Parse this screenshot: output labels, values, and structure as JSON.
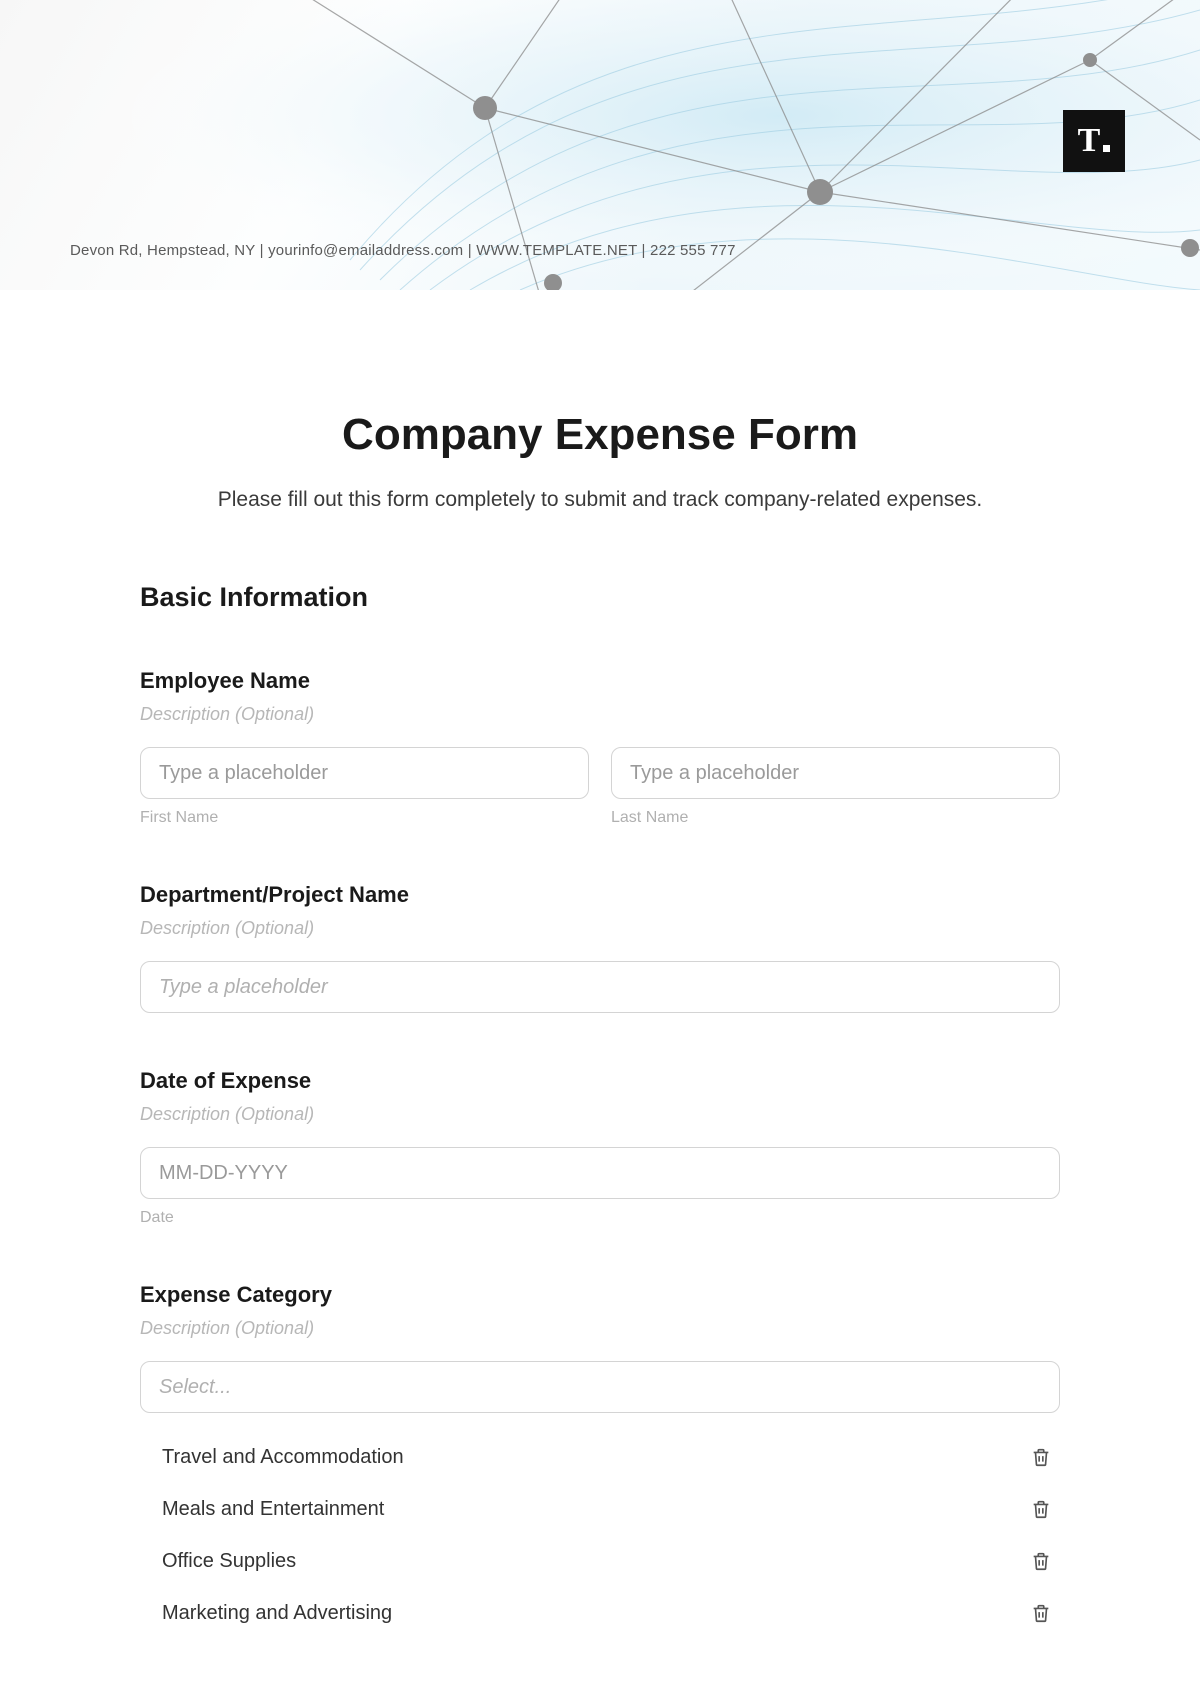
{
  "header": {
    "contact_line": "Devon Rd, Hempstead, NY | yourinfo@emailaddress.com | WWW.TEMPLATE.NET | 222 555 777",
    "logo_text": "T"
  },
  "title": "Company Expense Form",
  "subtitle": "Please fill out this form completely to submit and track company-related expenses.",
  "sections": {
    "basic_info": {
      "heading": "Basic Information",
      "employee_name": {
        "label": "Employee Name",
        "desc": "Description (Optional)",
        "first_placeholder": "Type a placeholder",
        "first_sublabel": "First Name",
        "last_placeholder": "Type a placeholder",
        "last_sublabel": "Last Name"
      },
      "department": {
        "label": "Department/Project Name",
        "desc": "Description (Optional)",
        "placeholder": "Type a placeholder"
      },
      "date": {
        "label": "Date of Expense",
        "desc": "Description (Optional)",
        "placeholder": "MM-DD-YYYY",
        "sublabel": "Date"
      },
      "category": {
        "label": "Expense Category",
        "desc": "Description (Optional)",
        "placeholder": "Select...",
        "options": [
          "Travel and Accommodation",
          "Meals and Entertainment",
          "Office Supplies",
          "Marketing and Advertising"
        ]
      }
    }
  }
}
